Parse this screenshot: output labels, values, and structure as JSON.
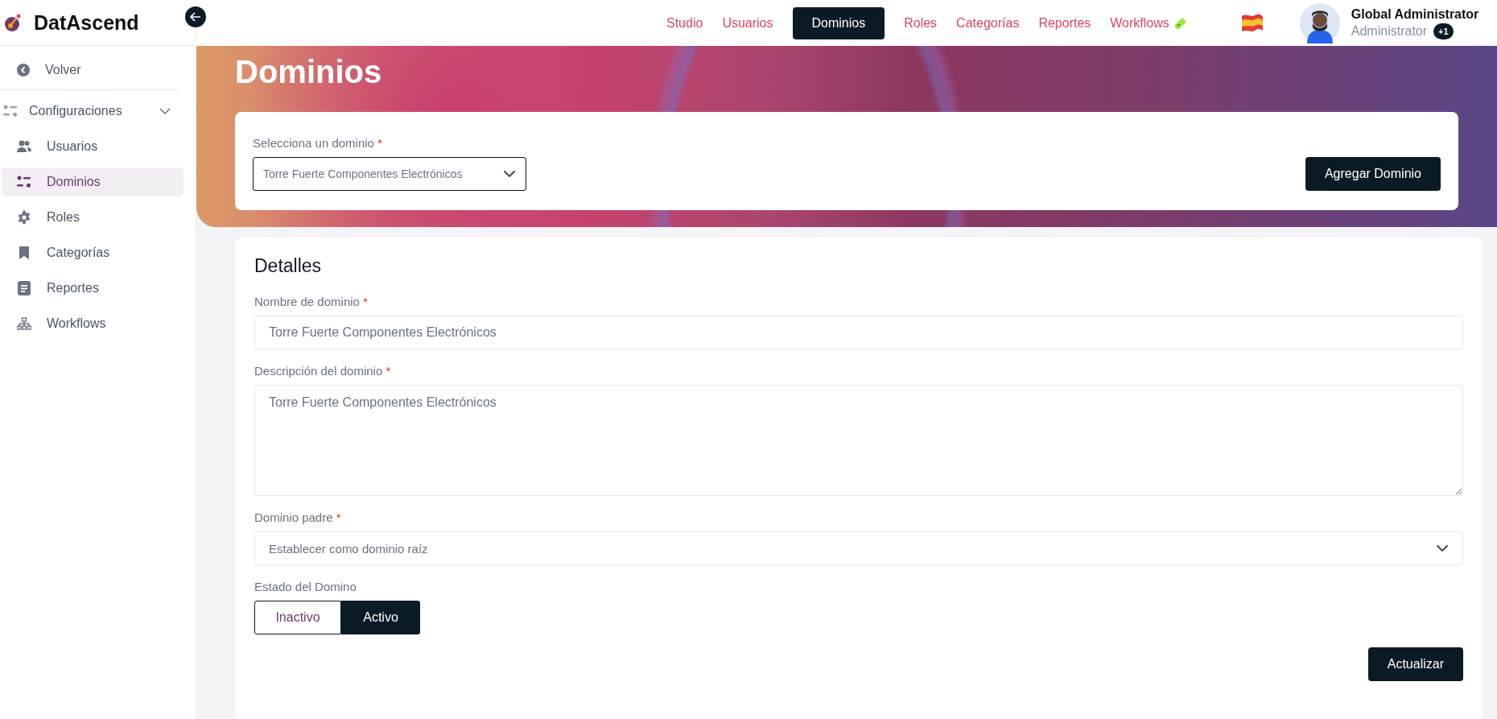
{
  "app": {
    "name": "DatAscend"
  },
  "top_nav": {
    "items": [
      {
        "label": "Studio",
        "selected": false,
        "kind": "text"
      },
      {
        "label": "Usuarios",
        "selected": false,
        "kind": "text"
      },
      {
        "label": "Dominios",
        "selected": true,
        "kind": "text"
      },
      {
        "label": "Roles",
        "selected": false,
        "kind": "text"
      },
      {
        "label": "Categorías",
        "selected": false,
        "kind": "text"
      },
      {
        "label": "Reportes",
        "selected": false,
        "kind": "text"
      },
      {
        "label": "Workflows",
        "selected": false,
        "kind": "flask"
      }
    ]
  },
  "user": {
    "name": "Global Administrator",
    "role": "Administrator",
    "extra_roles": "+1"
  },
  "sidebar": {
    "back": "Volver",
    "group": {
      "label": "Configuraciones",
      "expanded": true,
      "children": [
        {
          "label": "Usuarios",
          "kind": "users",
          "selected": false
        },
        {
          "label": "Dominios",
          "kind": "domains",
          "selected": true
        },
        {
          "label": "Roles",
          "kind": "gear",
          "selected": false
        },
        {
          "label": "Categorías",
          "kind": "bookmark",
          "selected": false
        },
        {
          "label": "Reportes",
          "kind": "report",
          "selected": false
        },
        {
          "label": "Workflows",
          "kind": "tree",
          "selected": false
        }
      ]
    }
  },
  "page": {
    "title": "Dominios"
  },
  "domain_picker": {
    "label": "Selecciona un dominio",
    "required_mark": "*",
    "value": "Torre Fuerte Componentes Electrónicos",
    "add_button": "Agregar Dominio"
  },
  "details": {
    "heading": "Detalles",
    "fields": [
      {
        "kind": "text",
        "label": "Nombre de dominio",
        "required_mark": "*",
        "value": "Torre Fuerte Componentes Electrónicos"
      },
      {
        "kind": "textarea",
        "label": "Descripción del dominio",
        "required_mark": "*",
        "value": "Torre Fuerte Componentes Electrónicos"
      },
      {
        "kind": "select",
        "label": "Dominio padre",
        "required_mark": "*",
        "value": "Establecer como dominio raíz"
      }
    ],
    "status": {
      "label": "Estado del Domino",
      "options": [
        {
          "label": "Inactivo",
          "selected": false
        },
        {
          "label": "Activo",
          "selected": true
        }
      ]
    },
    "submit": "Actualizar"
  }
}
